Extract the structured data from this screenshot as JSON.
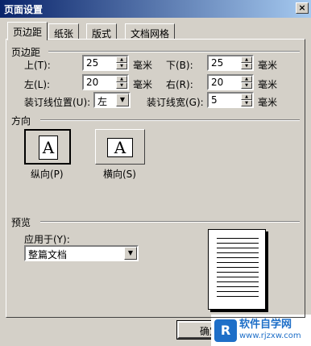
{
  "window": {
    "title": "页面设置",
    "close_glyph": "×"
  },
  "tabs": [
    {
      "label": "页边距"
    },
    {
      "label": "纸张"
    },
    {
      "label": "版式"
    },
    {
      "label": "文档网格"
    }
  ],
  "margins": {
    "section_label": "页边距",
    "top": {
      "label": "上(T):",
      "value": "25",
      "unit": "毫米"
    },
    "bottom": {
      "label": "下(B):",
      "value": "25",
      "unit": "毫米"
    },
    "left": {
      "label": "左(L):",
      "value": "20",
      "unit": "毫米"
    },
    "right": {
      "label": "右(R):",
      "value": "20",
      "unit": "毫米"
    },
    "gutter_position": {
      "label": "装订线位置(U):",
      "value": "左"
    },
    "gutter_width": {
      "label": "装订线宽(G):",
      "value": "5",
      "unit": "毫米"
    }
  },
  "orientation": {
    "section_label": "方向",
    "portrait": {
      "label": "纵向(P)",
      "glyph": "A"
    },
    "landscape": {
      "label": "横向(S)",
      "glyph": "A"
    }
  },
  "preview": {
    "section_label": "预览",
    "apply_label": "应用于(Y):",
    "apply_value": "整篇文档"
  },
  "buttons": {
    "ok": "确定"
  },
  "watermark": {
    "logo": "R",
    "title": "软件自学网",
    "url": "www.rjzxw.com"
  },
  "colors": {
    "face": "#d4d0c8",
    "title_start": "#0a246a",
    "title_end": "#a6caf0"
  }
}
